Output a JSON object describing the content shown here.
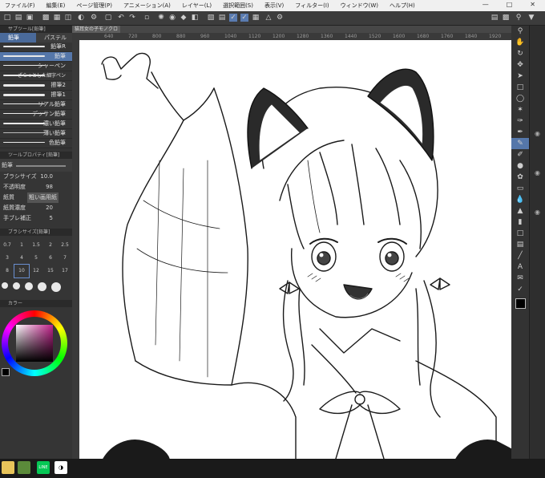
{
  "menu": [
    "ファイル(F)",
    "編集(E)",
    "ページ管理(P)",
    "アニメーション(A)",
    "レイヤー(L)",
    "選択範囲(S)",
    "表示(V)",
    "フィルター(I)",
    "ウィンドウ(W)",
    "ヘルプ(H)"
  ],
  "subtool_header": "サブツール[鉛筆]",
  "subtool_tabs": [
    "鉛筆",
    "パステル"
  ],
  "brushes": [
    "鉛筆R",
    "鉛筆",
    "シャーペン",
    "ざらっとした細字ペン",
    "擦筆2",
    "擦筆1",
    "リアル鉛筆",
    "デッサン鉛筆",
    "濃い鉛筆",
    "薄い鉛筆",
    "色鉛筆"
  ],
  "tool_property_header": "ツールプロパティ[鉛筆]",
  "tool_property_name": "鉛筆",
  "props": {
    "brush_size_label": "ブラシサイズ",
    "brush_size_value": "10.0",
    "opacity_label": "不透明度",
    "opacity_value": "98",
    "paper_texture_label": "紙質",
    "paper_texture_value": "粗い画用紙",
    "paper_density_label": "紙質濃度",
    "paper_density_value": "20",
    "stabilization_label": "手ブレ補正",
    "stabilization_value": "5"
  },
  "brush_size_header": "ブラシサイズ[鉛筆]",
  "size_values": [
    "0.7",
    "1",
    "1.5",
    "2",
    "2.5",
    "3",
    "4",
    "5",
    "6",
    "7",
    "8",
    "10",
    "12",
    "15",
    "17"
  ],
  "color_header": "カラー",
  "document_tab": "猫耳女の子モノクロ",
  "ruler_ticks": [
    "640",
    "720",
    "800",
    "880",
    "960",
    "1040",
    "1120",
    "1200",
    "1280",
    "1360",
    "1440",
    "1520",
    "1600",
    "1680",
    "1760",
    "1840",
    "1920"
  ],
  "colors": {
    "menubar_bg": "#f0f0f0",
    "panel_bg": "#353535",
    "selection": "#5577aa",
    "canvas_bg": "#474747",
    "paper": "#ffffff",
    "main_color": "#000000"
  },
  "taskbar_icons": [
    "folder-icon",
    "minecraft-icon",
    "line-icon",
    "clip-studio-icon"
  ],
  "taskbar_line_label": "LINE"
}
